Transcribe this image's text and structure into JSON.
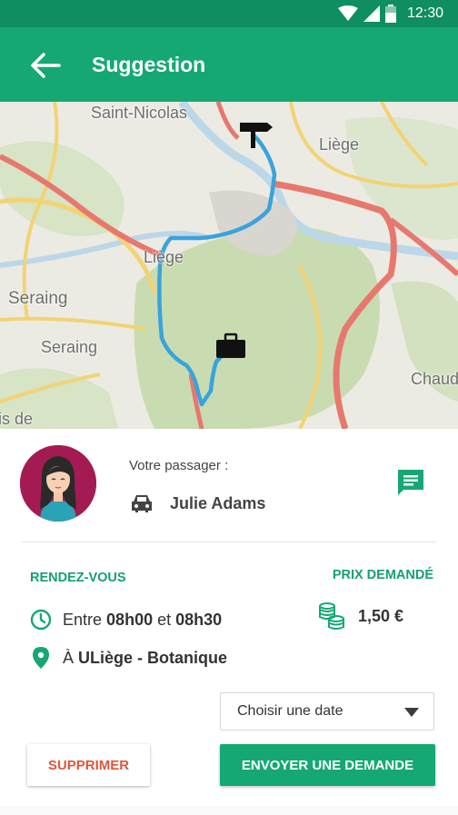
{
  "status_bar": {
    "time": "12:30"
  },
  "app_bar": {
    "title": "Suggestion"
  },
  "map": {
    "labels": {
      "saint_nicolas": "Saint-Nicolas",
      "liege_ne": "Liège",
      "liege_center": "Liège",
      "seraing_1": "Seraing",
      "seraing_2": "Seraing",
      "chaud": "Chaud",
      "is_de": "is de"
    }
  },
  "passenger": {
    "caption": "Votre passager :",
    "name": "Julie Adams"
  },
  "meeting": {
    "title": "RENDEZ-VOUS",
    "time_prefix": "Entre",
    "time_from": "08h00",
    "time_joiner": "et",
    "time_to": "08h30",
    "place_prefix": "À",
    "place": "ULiège - Botanique"
  },
  "price": {
    "title": "PRIX DEMANDÉ",
    "value": "1,50 €"
  },
  "date_select": {
    "label": "Choisir une date"
  },
  "actions": {
    "delete_label": "SUPPRIMER",
    "send_label": "ENVOYER UNE DEMANDE"
  },
  "colors": {
    "primary": "#15a872",
    "status_bar": "#0f8e60",
    "danger": "#e0563b",
    "route": "#3aa3dc",
    "avatar_bg": "#a41b54"
  },
  "icons": [
    "wifi-icon",
    "signal-icon",
    "battery-icon",
    "back-arrow-icon",
    "car-icon",
    "chat-icon",
    "clock-icon",
    "location-pin-icon",
    "coins-icon",
    "start-signpost-icon",
    "destination-briefcase-icon"
  ]
}
